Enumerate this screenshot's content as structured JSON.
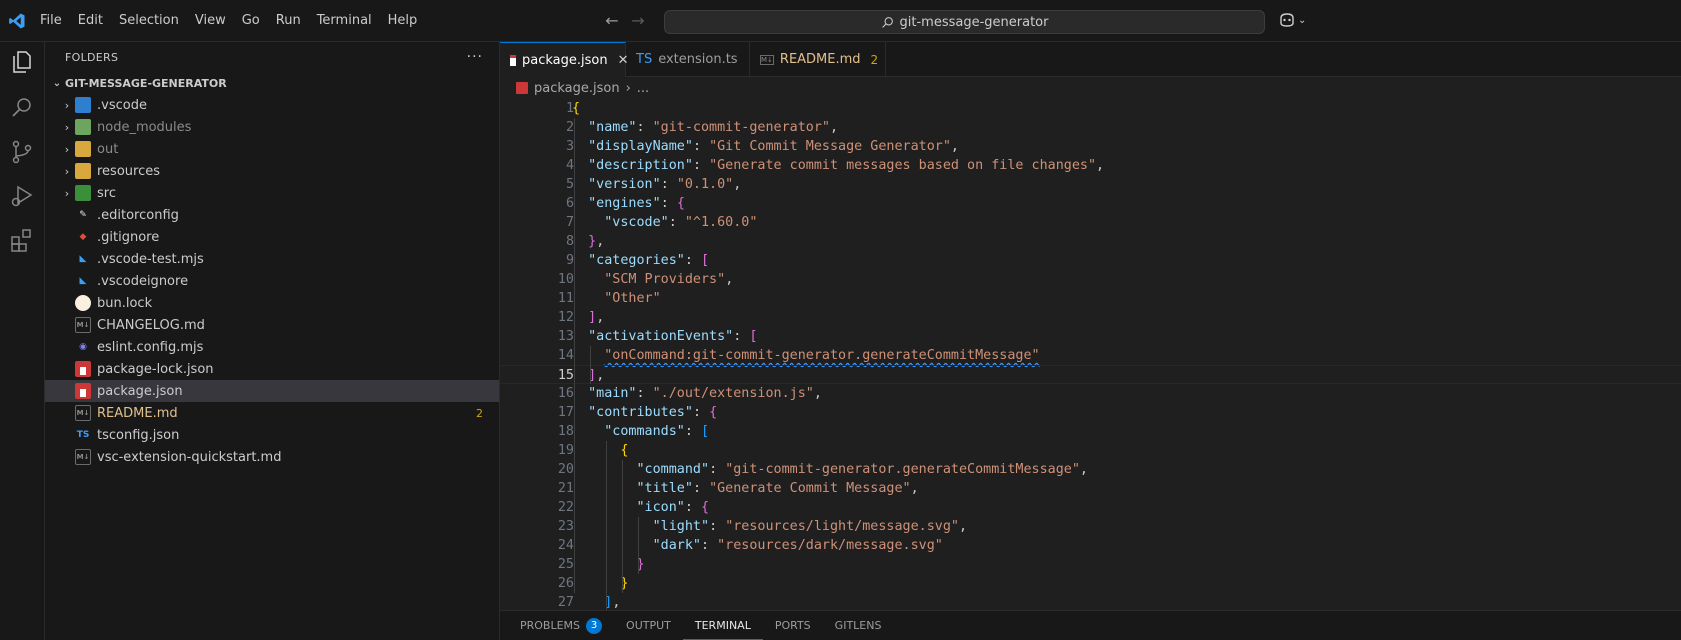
{
  "menu": [
    "File",
    "Edit",
    "Selection",
    "View",
    "Go",
    "Run",
    "Terminal",
    "Help"
  ],
  "search": {
    "text": "git-message-generator"
  },
  "sidebar": {
    "header": "FOLDERS",
    "section": "GIT-MESSAGE-GENERATOR",
    "items": [
      {
        "label": ".vscode",
        "type": "folder",
        "icon": "vscode-folder-icon"
      },
      {
        "label": "node_modules",
        "type": "folder",
        "icon": "node-folder-icon"
      },
      {
        "label": "out",
        "type": "folder",
        "icon": "folder-icon"
      },
      {
        "label": "resources",
        "type": "folder",
        "icon": "folder-icon"
      },
      {
        "label": "src",
        "type": "folder",
        "icon": "src-folder-icon"
      },
      {
        "label": ".editorconfig",
        "type": "file",
        "icon": "editorconfig-icon"
      },
      {
        "label": ".gitignore",
        "type": "file",
        "icon": "git-icon"
      },
      {
        "label": ".vscode-test.mjs",
        "type": "file",
        "icon": "vscode-icon"
      },
      {
        "label": ".vscodeignore",
        "type": "file",
        "icon": "vscode-icon"
      },
      {
        "label": "bun.lock",
        "type": "file",
        "icon": "bun-icon"
      },
      {
        "label": "CHANGELOG.md",
        "type": "file",
        "icon": "markdown-icon"
      },
      {
        "label": "eslint.config.mjs",
        "type": "file",
        "icon": "eslint-icon"
      },
      {
        "label": "package-lock.json",
        "type": "file",
        "icon": "npm-icon"
      },
      {
        "label": "package.json",
        "type": "file",
        "icon": "npm-icon"
      },
      {
        "label": "README.md",
        "type": "file",
        "icon": "markdown-icon",
        "count": "2"
      },
      {
        "label": "tsconfig.json",
        "type": "file",
        "icon": "tsconfig-icon"
      },
      {
        "label": "vsc-extension-quickstart.md",
        "type": "file",
        "icon": "markdown-icon"
      }
    ]
  },
  "tabs": [
    {
      "label": "package.json",
      "icon": "npm-icon",
      "active": true
    },
    {
      "label": "extension.ts",
      "icon": "typescript-icon",
      "active": false
    },
    {
      "label": "README.md",
      "icon": "markdown-icon",
      "active": false,
      "count": "2"
    }
  ],
  "breadcrumb": {
    "file": "package.json",
    "rest": "..."
  },
  "code": {
    "active_line": 15,
    "lines": [
      [
        [
          "b1",
          "{"
        ]
      ],
      [
        [
          "p",
          "  "
        ],
        [
          "k",
          "\"name\""
        ],
        [
          "p",
          ": "
        ],
        [
          "s",
          "\"git-commit-generator\""
        ],
        [
          "p",
          ","
        ]
      ],
      [
        [
          "p",
          "  "
        ],
        [
          "k",
          "\"displayName\""
        ],
        [
          "p",
          ": "
        ],
        [
          "s",
          "\"Git Commit Message Generator\""
        ],
        [
          "p",
          ","
        ]
      ],
      [
        [
          "p",
          "  "
        ],
        [
          "k",
          "\"description\""
        ],
        [
          "p",
          ": "
        ],
        [
          "s",
          "\"Generate commit messages based on file changes\""
        ],
        [
          "p",
          ","
        ]
      ],
      [
        [
          "p",
          "  "
        ],
        [
          "k",
          "\"version\""
        ],
        [
          "p",
          ": "
        ],
        [
          "s",
          "\"0.1.0\""
        ],
        [
          "p",
          ","
        ]
      ],
      [
        [
          "p",
          "  "
        ],
        [
          "k",
          "\"engines\""
        ],
        [
          "p",
          ": "
        ],
        [
          "b2",
          "{"
        ]
      ],
      [
        [
          "p",
          "    "
        ],
        [
          "k",
          "\"vscode\""
        ],
        [
          "p",
          ": "
        ],
        [
          "s",
          "\"^1.60.0\""
        ]
      ],
      [
        [
          "p",
          "  "
        ],
        [
          "b2",
          "}"
        ],
        [
          "p",
          ","
        ]
      ],
      [
        [
          "p",
          "  "
        ],
        [
          "k",
          "\"categories\""
        ],
        [
          "p",
          ": "
        ],
        [
          "b2",
          "["
        ]
      ],
      [
        [
          "p",
          "    "
        ],
        [
          "s",
          "\"SCM Providers\""
        ],
        [
          "p",
          ","
        ]
      ],
      [
        [
          "p",
          "    "
        ],
        [
          "s",
          "\"Other\""
        ]
      ],
      [
        [
          "p",
          "  "
        ],
        [
          "b2",
          "]"
        ],
        [
          "p",
          ","
        ]
      ],
      [
        [
          "p",
          "  "
        ],
        [
          "k",
          "\"activationEvents\""
        ],
        [
          "p",
          ": "
        ],
        [
          "b2",
          "["
        ]
      ],
      [
        [
          "p",
          "    "
        ],
        [
          "sq",
          "\"onCommand:git-commit-generator.generateCommitMessage\""
        ]
      ],
      [
        [
          "p",
          "  "
        ],
        [
          "b2",
          "]"
        ],
        [
          "p",
          ","
        ]
      ],
      [
        [
          "p",
          "  "
        ],
        [
          "k",
          "\"main\""
        ],
        [
          "p",
          ": "
        ],
        [
          "s",
          "\"./out/extension.js\""
        ],
        [
          "p",
          ","
        ]
      ],
      [
        [
          "p",
          "  "
        ],
        [
          "k",
          "\"contributes\""
        ],
        [
          "p",
          ": "
        ],
        [
          "b2",
          "{"
        ]
      ],
      [
        [
          "p",
          "    "
        ],
        [
          "k",
          "\"commands\""
        ],
        [
          "p",
          ": "
        ],
        [
          "b3",
          "["
        ]
      ],
      [
        [
          "p",
          "      "
        ],
        [
          "b1",
          "{"
        ]
      ],
      [
        [
          "p",
          "        "
        ],
        [
          "k",
          "\"command\""
        ],
        [
          "p",
          ": "
        ],
        [
          "s",
          "\"git-commit-generator.generateCommitMessage\""
        ],
        [
          "p",
          ","
        ]
      ],
      [
        [
          "p",
          "        "
        ],
        [
          "k",
          "\"title\""
        ],
        [
          "p",
          ": "
        ],
        [
          "s",
          "\"Generate Commit Message\""
        ],
        [
          "p",
          ","
        ]
      ],
      [
        [
          "p",
          "        "
        ],
        [
          "k",
          "\"icon\""
        ],
        [
          "p",
          ": "
        ],
        [
          "b2",
          "{"
        ]
      ],
      [
        [
          "p",
          "          "
        ],
        [
          "k",
          "\"light\""
        ],
        [
          "p",
          ": "
        ],
        [
          "s",
          "\"resources/light/message.svg\""
        ],
        [
          "p",
          ","
        ]
      ],
      [
        [
          "p",
          "          "
        ],
        [
          "k",
          "\"dark\""
        ],
        [
          "p",
          ": "
        ],
        [
          "s",
          "\"resources/dark/message.svg\""
        ]
      ],
      [
        [
          "p",
          "        "
        ],
        [
          "b2",
          "}"
        ]
      ],
      [
        [
          "p",
          "      "
        ],
        [
          "b1",
          "}"
        ]
      ],
      [
        [
          "p",
          "    "
        ],
        [
          "b3",
          "]"
        ],
        [
          "p",
          ","
        ]
      ]
    ]
  },
  "panel": {
    "tabs": [
      {
        "label": "PROBLEMS",
        "count": "3"
      },
      {
        "label": "OUTPUT"
      },
      {
        "label": "TERMINAL",
        "active": true
      },
      {
        "label": "PORTS"
      },
      {
        "label": "GITLENS"
      }
    ]
  },
  "colors": {
    "accent": "#0078d4",
    "badge": "#cca700",
    "modified": "#e2c08d"
  }
}
